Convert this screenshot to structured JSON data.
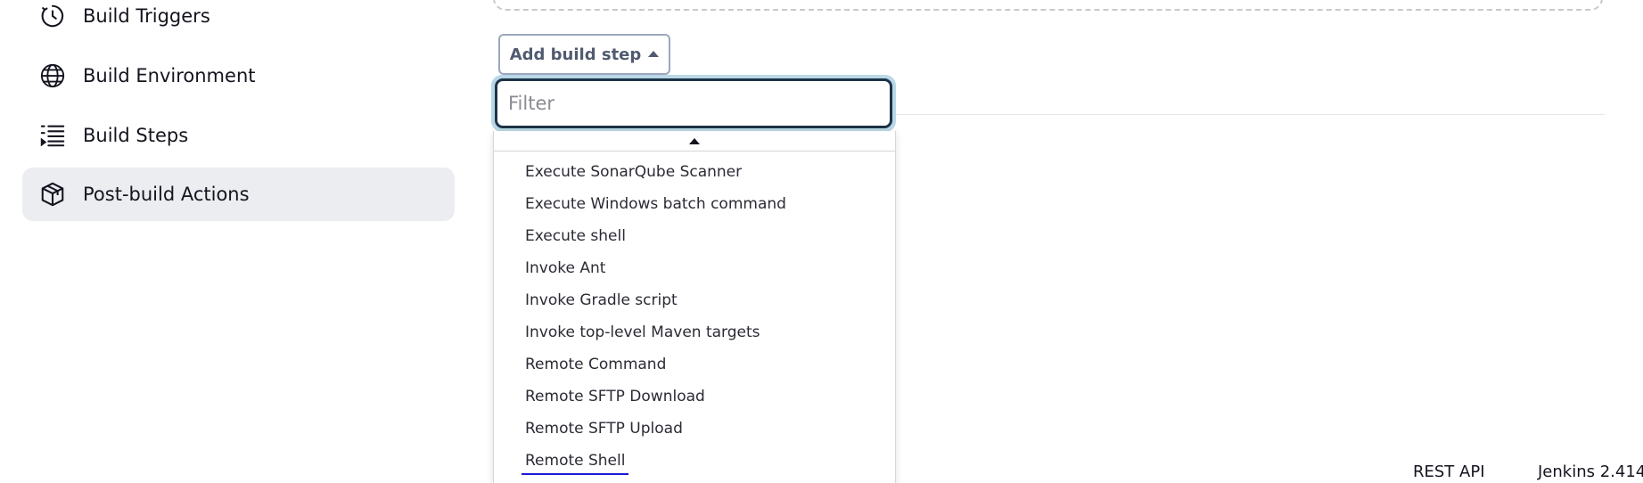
{
  "sidebar": {
    "items": [
      {
        "label": "Build Triggers",
        "icon": "clock-icon"
      },
      {
        "label": "Build Environment",
        "icon": "globe-icon"
      },
      {
        "label": "Build Steps",
        "icon": "list-icon"
      },
      {
        "label": "Post-build Actions",
        "icon": "package-icon",
        "active": true
      }
    ]
  },
  "toolbar": {
    "add_step_label": "Add build step"
  },
  "filter": {
    "placeholder": "Filter",
    "value": ""
  },
  "dropdown": {
    "items": [
      "Execute SonarQube Scanner",
      "Execute Windows batch command",
      "Execute shell",
      "Invoke Ant",
      "Invoke Gradle script",
      "Invoke top-level Maven targets",
      "Remote Command",
      "Remote SFTP Download",
      "Remote SFTP Upload",
      "Remote Shell"
    ],
    "hovered": "Remote Shell"
  },
  "footer": {
    "rest_api": "REST API",
    "version": "Jenkins 2.414."
  },
  "colors": {
    "active_bg": "#ebedf0",
    "focus_ring": "#b9d7e6",
    "input_border": "#1d3347",
    "button_border": "#9ba7bf",
    "hover_underline": "#1a1ad6"
  }
}
